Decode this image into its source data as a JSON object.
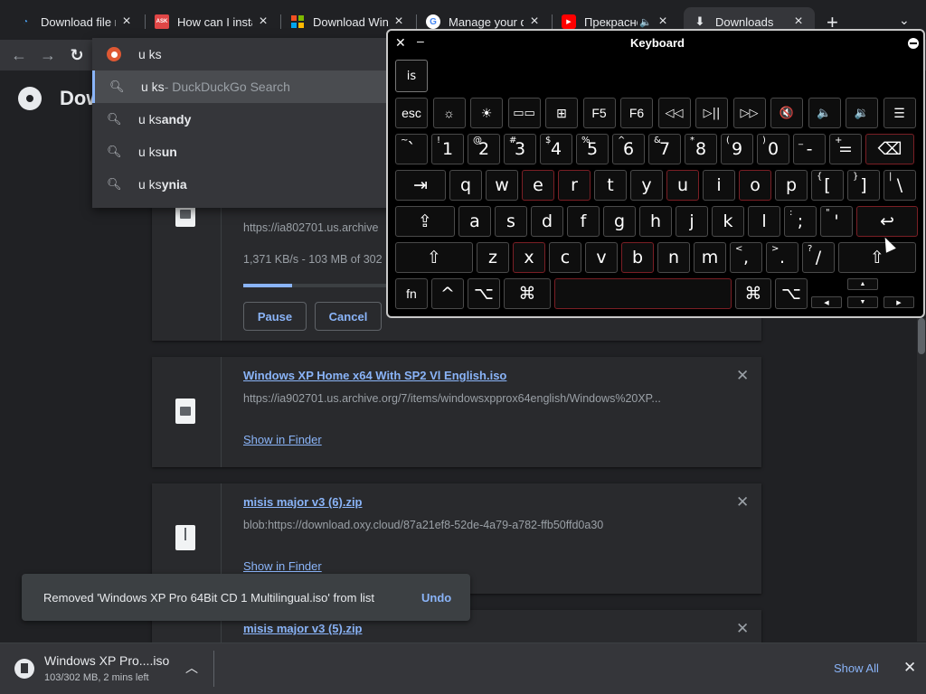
{
  "tabs": [
    {
      "title": "Download file r",
      "favicon": "download-favicon",
      "color": "#4a9eed"
    },
    {
      "title": "How can I insta",
      "favicon": "ask-favicon",
      "badge": "ASK",
      "color": "#e04646"
    },
    {
      "title": "Download Wind",
      "favicon": "windows-favicon",
      "color": "#00a4ef"
    },
    {
      "title": "Manage your d",
      "favicon": "google-favicon",
      "color": "#4285f4"
    },
    {
      "title": "Прекрасно",
      "favicon": "youtube-favicon",
      "color": "#ff0000"
    },
    {
      "title": "Downloads",
      "favicon": "download-arrow-icon",
      "color": "#e8eaed"
    }
  ],
  "omnibox": {
    "input": "u ks",
    "suggestions": [
      {
        "prefix": "u ks",
        "suffix": " - DuckDuckGo Search"
      },
      {
        "prefix": "u ks",
        "suffix": "andy"
      },
      {
        "prefix": "u ks",
        "suffix": "un"
      },
      {
        "prefix": "u ks",
        "suffix": "ynia"
      }
    ]
  },
  "page": {
    "title_visible": "Dow"
  },
  "downloads": {
    "active": {
      "url": "https://ia802701.us.archive",
      "progress_text": "1,371 KB/s - 103 MB of 302",
      "progress_fraction": 0.34,
      "pause_label": "Pause",
      "cancel_label": "Cancel"
    },
    "items": [
      {
        "name": "Windows XP Home x64 With SP2 Vl English.iso",
        "url": "https://ia902701.us.archive.org/7/items/windowsxpprox64english/Windows%20XP...",
        "show_label": "Show in Finder"
      },
      {
        "name": "misis major v3 (6).zip",
        "url": "blob:https://download.oxy.cloud/87a21ef8-52de-4a79-a782-ffb50ffd0a30",
        "show_label": "Show in Finder"
      },
      {
        "name": "misis major v3 (5).zip"
      }
    ]
  },
  "toast": {
    "message": "Removed 'Windows XP Pro 64Bit CD 1 Multilingual.iso' from list",
    "undo_label": "Undo"
  },
  "shelf": {
    "filename": "Windows XP Pro....iso",
    "status": "103/302 MB, 2 mins left",
    "show_all_label": "Show All"
  },
  "keyboard": {
    "title": "Keyboard",
    "candidate": "is",
    "fn_row": [
      "esc",
      "☼",
      "☀",
      "▭▭",
      "⊞",
      "F5",
      "F6",
      "◁◁",
      "▷||",
      "▷▷",
      "🔇",
      "🔈",
      "🔉",
      "☰"
    ],
    "number_row": [
      {
        "main": "`",
        "shift": "~"
      },
      {
        "main": "1",
        "shift": "!"
      },
      {
        "main": "2",
        "shift": "@"
      },
      {
        "main": "3",
        "shift": "#"
      },
      {
        "main": "4",
        "shift": "$"
      },
      {
        "main": "5",
        "shift": "%"
      },
      {
        "main": "6",
        "shift": "^"
      },
      {
        "main": "7",
        "shift": "&"
      },
      {
        "main": "8",
        "shift": "*"
      },
      {
        "main": "9",
        "shift": "("
      },
      {
        "main": "0",
        "shift": ")"
      },
      {
        "main": "-",
        "shift": "_"
      },
      {
        "main": "=",
        "shift": "+"
      },
      {
        "main": "⌫",
        "shift": ""
      }
    ],
    "row_q": [
      "⇥",
      "q",
      "w",
      "e",
      "r",
      "t",
      "y",
      "u",
      "i",
      "o",
      "p",
      "[",
      "]",
      "\\"
    ],
    "row_q_shift": [
      "",
      "",
      "",
      "",
      "",
      "",
      "",
      "",
      "",
      "",
      "",
      "{",
      "}",
      "|"
    ],
    "row_a": [
      "⇪",
      "a",
      "s",
      "d",
      "f",
      "g",
      "h",
      "j",
      "k",
      "l",
      ";",
      "'",
      "↩"
    ],
    "row_a_shift": [
      "",
      "",
      "",
      "",
      "",
      "",
      "",
      "",
      "",
      "",
      ":",
      "\"",
      ""
    ],
    "row_z": [
      "⇧",
      "z",
      "x",
      "c",
      "v",
      "b",
      "n",
      "m",
      ",",
      ".",
      "/",
      "⇧"
    ],
    "row_z_shift": [
      "",
      "",
      "",
      "",
      "",
      "",
      "",
      "",
      "<",
      ">",
      "?",
      ""
    ],
    "row_bottom": [
      "fn",
      "^",
      "⌥",
      "⌘",
      "",
      "⌘",
      "⌥"
    ],
    "arrows": [
      "▲",
      "◀",
      "▼",
      "▶"
    ]
  }
}
